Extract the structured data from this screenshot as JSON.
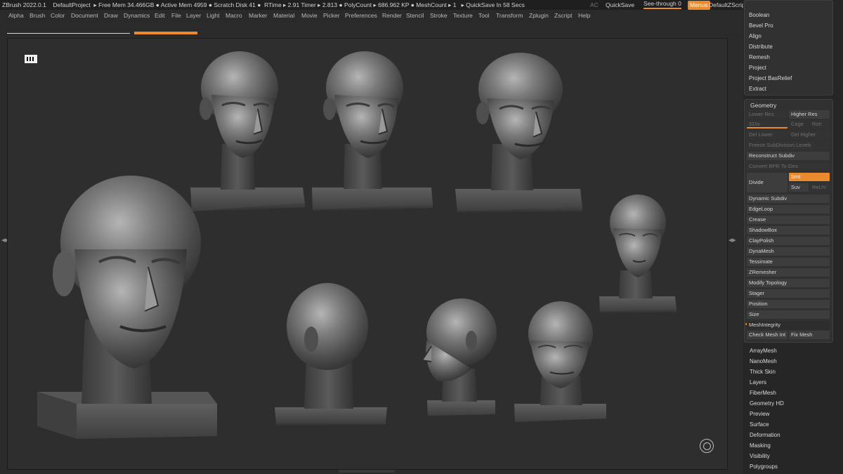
{
  "titlebar": {
    "app": "ZBrush 2022.0.1",
    "project": "DefaultProject",
    "free_mem": "Free Mem 34.466GB",
    "active_mem": "Active Mem 4959",
    "scratch": "Scratch Disk 41",
    "rtime": "RTime ▸ 2.91",
    "timer": "Timer ▸ 2.813",
    "polycount": "PolyCount ▸ 686.962 KP",
    "meshcount": "MeshCount ▸ 1",
    "quicksave_in": "QuickSave In 58 Secs",
    "ac": "AC",
    "quicksave": "QuickSave",
    "see_through": "See-through  0",
    "menus": "Menus",
    "script": "DefaultZScript"
  },
  "menubar": [
    "Alpha",
    "Brush",
    "Color",
    "Document",
    "Draw",
    "Dynamics",
    "Edit",
    "File",
    "Layer",
    "Light",
    "Macro",
    "Marker",
    "Material",
    "Movie",
    "Picker",
    "Preferences",
    "Render",
    "Stencil",
    "Stroke",
    "Texture",
    "Tool",
    "Transform",
    "Zplugin",
    "Zscript",
    "Help"
  ],
  "right_panel": {
    "top_items": [
      "Boolean",
      "Bevel Pro",
      "Align",
      "Distribute",
      "Remesh",
      "Project",
      "Project BasRelief",
      "Extract"
    ],
    "geometry": {
      "title": "Geometry",
      "lower_res": "Lower Res",
      "higher_res": "Higher Res",
      "sdiv": "SDiv",
      "cage": "Cage",
      "rstr": "Rstr",
      "del_lower": "Del Lower",
      "del_higher": "Del Higher",
      "freeze": "Freeze SubDivision Levels",
      "reconstruct": "Reconstruct Subdiv",
      "convert": "Convert BPR To Geo",
      "divide": "Divide",
      "smt": "Smt",
      "suv": "Suv",
      "reuv": "ReUV",
      "items": [
        "Dynamic Subdiv",
        "EdgeLoop",
        "Crease",
        "ShadowBox",
        "ClayPolish",
        "DynaMesh",
        "Tessimate",
        "ZRemesher",
        "Modify Topology",
        "Stager",
        "Position",
        "Size",
        "MeshIntegrity"
      ],
      "check_mesh": "Check Mesh Int",
      "fix_mesh": "Fix Mesh"
    },
    "bottom_items": [
      "ArrayMesh",
      "NanoMesh",
      "Thick Skin",
      "Layers",
      "FiberMesh",
      "Geometry HD",
      "Preview",
      "Surface",
      "Deformation",
      "Masking",
      "Visibility",
      "Polygroups"
    ]
  },
  "accent": "#e98a2c"
}
